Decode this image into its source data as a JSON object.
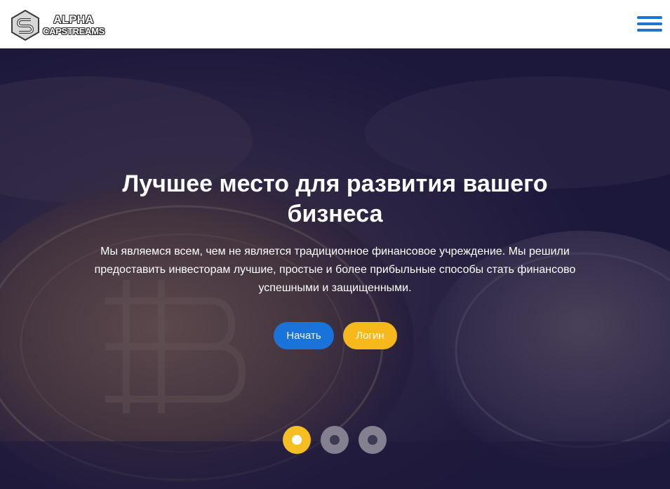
{
  "header": {
    "logo": {
      "line1": "ALPHA",
      "line2": "CAPSTREAMS"
    },
    "menu_icon": "hamburger-menu-icon"
  },
  "hero": {
    "title": "Лучшее место для развития вашего бизнеса",
    "text": "Мы являемся всем, чем не является традиционное финансовое учреждение. Мы решили предоставить инвесторам лучшие, простые и более прибыльные способы стать финансово успешными и защищенными.",
    "buttons": {
      "start_label": "Начать",
      "login_label": "Логин"
    },
    "slider": {
      "count": 3,
      "active_index": 0
    },
    "background": "bitcoin coins photo with dark blue overlay"
  },
  "colors": {
    "primary_blue": "#1a73d8",
    "accent_yellow": "#f6b81b",
    "overlay": "#18143a"
  }
}
